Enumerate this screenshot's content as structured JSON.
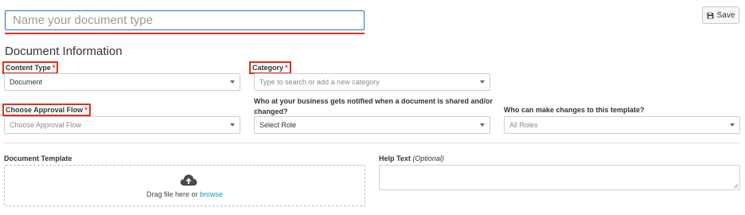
{
  "header": {
    "name_placeholder": "Name your document type",
    "save_label": "Save"
  },
  "section_title": "Document Information",
  "fields": {
    "content_type": {
      "label": "Content Type",
      "required": "*",
      "value": "Document"
    },
    "category": {
      "label": "Category",
      "required": "*",
      "placeholder": "Type to search or add a new category"
    },
    "approval_flow": {
      "label": "Choose Approval Flow",
      "required": "*",
      "placeholder": "Choose Approval Flow"
    },
    "notified": {
      "label_line1": "Who at your business gets notified when a document is shared and/or",
      "label_line2": "changed?",
      "placeholder": "Select Role"
    },
    "editors": {
      "label": "Who can make changes to this template?",
      "value": "All Roles"
    }
  },
  "document_template": {
    "label": "Document Template",
    "drop_text": "Drag file here or",
    "browse_label": "browse"
  },
  "help_text": {
    "label": "Help Text",
    "optional": "(Optional)"
  },
  "colors": {
    "required_highlight": "#e0301e",
    "focus_border": "#2a6ec4",
    "link": "#1b9aa8"
  },
  "icons": {
    "save": "floppy-disk-icon",
    "upload": "cloud-upload-icon",
    "dropdown": "caret-down-icon"
  }
}
